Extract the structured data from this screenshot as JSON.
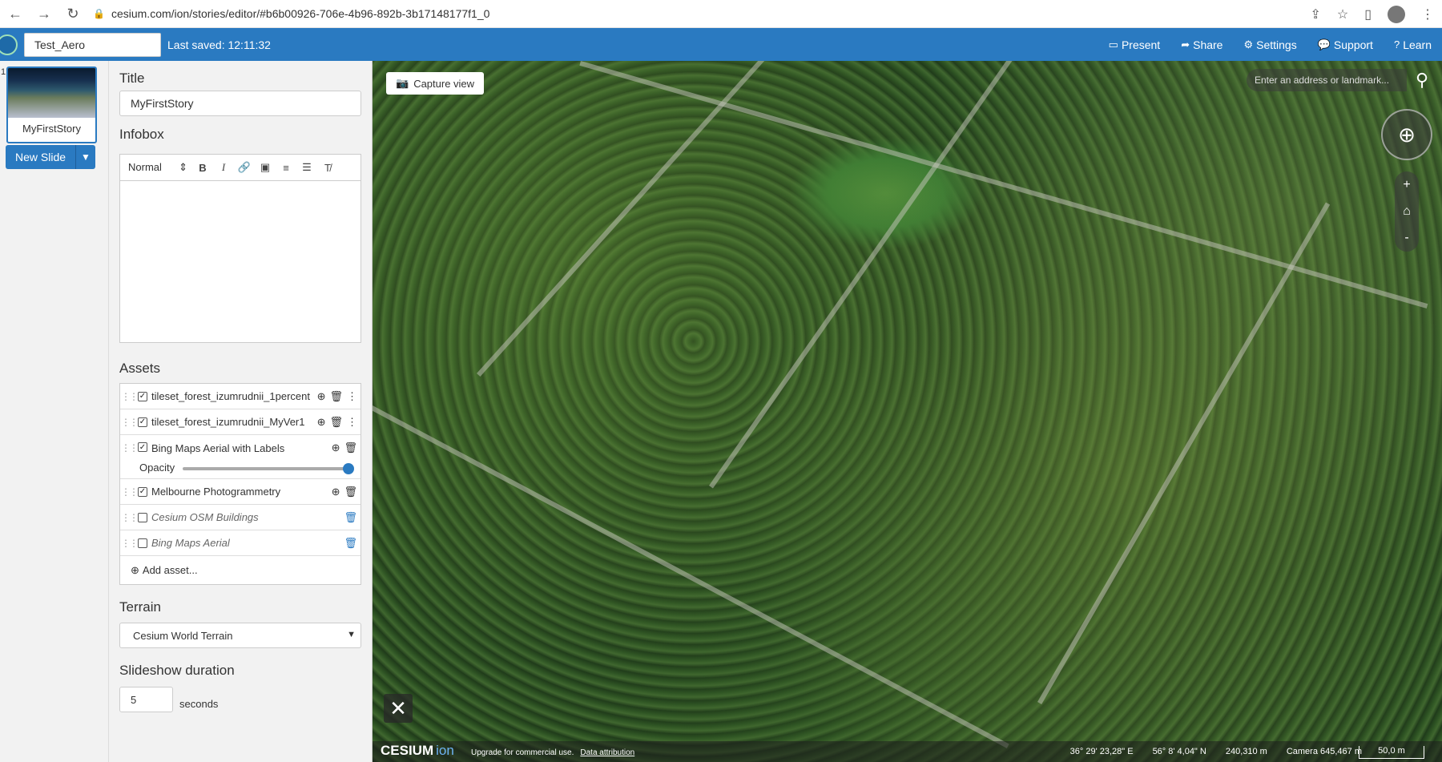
{
  "browser": {
    "url": "cesium.com/ion/stories/editor/#b6b00926-706e-4b96-892b-3b17148177f1_0"
  },
  "appbar": {
    "project_name": "Test_Aero",
    "last_saved": "Last saved: 12:11:32",
    "menu": [
      {
        "label": "Present",
        "icon": "monitor-icon"
      },
      {
        "label": "Share",
        "icon": "share-icon"
      },
      {
        "label": "Settings",
        "icon": "gear-icon"
      },
      {
        "label": "Support",
        "icon": "chat-icon"
      },
      {
        "label": "Learn",
        "icon": "help-icon"
      }
    ]
  },
  "slides": {
    "items": [
      {
        "number": "1",
        "label": "MyFirstStory"
      }
    ],
    "new_slide_label": "New Slide"
  },
  "editor": {
    "title_heading": "Title",
    "title_value": "MyFirstStory",
    "infobox_heading": "Infobox",
    "format_select": "Normal",
    "assets_heading": "Assets",
    "assets": [
      {
        "name": "tileset_forest_izumrudnii_1percent",
        "checked": true
      },
      {
        "name": "tileset_forest_izumrudnii_MyVer1",
        "checked": true
      },
      {
        "name": "Bing Maps Aerial with Labels",
        "checked": true,
        "opacity_label": "Opacity",
        "opacity": 1.0
      },
      {
        "name": "Melbourne Photogrammetry",
        "checked": true
      },
      {
        "name": "Cesium OSM Buildings",
        "checked": false
      },
      {
        "name": "Bing Maps Aerial",
        "checked": false
      }
    ],
    "add_asset_label": "Add asset...",
    "terrain_heading": "Terrain",
    "terrain_value": "Cesium World Terrain",
    "duration_heading": "Slideshow duration",
    "duration_value": "5",
    "duration_unit": "seconds"
  },
  "map": {
    "capture_label": "Capture view",
    "search_placeholder": "Enter an address or landmark...",
    "zoom_in": "+",
    "zoom_out": "-",
    "logo_text": "CESIUM",
    "logo_ion": "ion",
    "upgrade_text": "Upgrade for commercial use.",
    "attribution_text": "Data attribution",
    "longitude": "36° 29' 23,28\" E",
    "latitude": "56° 8' 4,04\" N",
    "elevation": "240,310 m",
    "camera": "Camera 645,467 m",
    "scale": "50,0 m"
  }
}
